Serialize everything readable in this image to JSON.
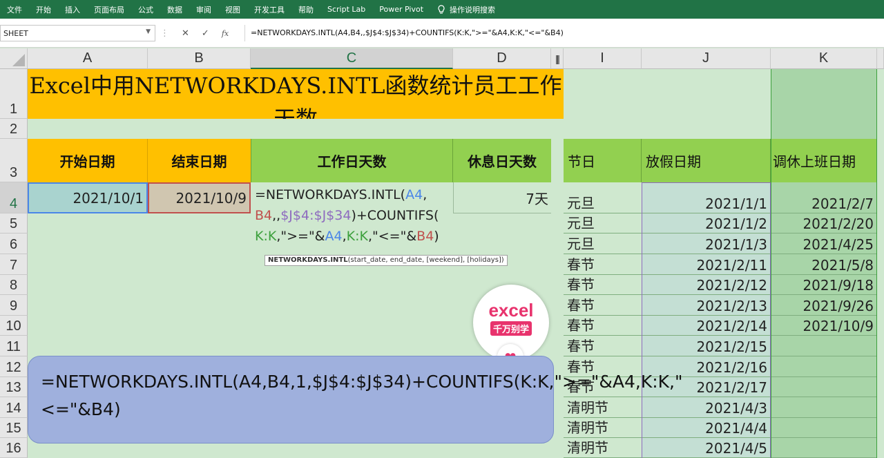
{
  "ribbon": {
    "tabs": [
      "文件",
      "开始",
      "插入",
      "页面布局",
      "公式",
      "数据",
      "审阅",
      "视图",
      "开发工具",
      "帮助",
      "Script Lab",
      "Power Pivot"
    ],
    "tell_me": "操作说明搜索"
  },
  "formula_bar": {
    "name_box": "SHEET",
    "formula": "=NETWORKDAYS.INTL(A4,B4,,$J$4:$J$34)+COUNTIFS(K:K,\">=\"&A4,K:K,\"<=\"&B4)",
    "fx": "fx"
  },
  "columns": [
    {
      "label": "A"
    },
    {
      "label": "B"
    },
    {
      "label": "C"
    },
    {
      "label": "D"
    },
    {
      "label": "I"
    },
    {
      "label": "J"
    },
    {
      "label": "K"
    }
  ],
  "rows": [
    "1",
    "2",
    "3",
    "4",
    "5",
    "6",
    "7",
    "8",
    "9",
    "10",
    "11",
    "12",
    "13",
    "14",
    "15",
    "16"
  ],
  "title": "Excel中用NETWORKDAYS.INTL函数统计员工工作天数",
  "headers": {
    "start": "开始日期",
    "end": "结束日期",
    "workdays": "工作日天数",
    "restdays": "休息日天数",
    "holiday": "节日",
    "holiday_date": "放假日期",
    "makeup_date": "调休上班日期"
  },
  "row4": {
    "start": "2021/10/1",
    "end": "2021/10/9",
    "rest": "7天"
  },
  "edit_formula": {
    "l1a": "=NETWORKDAYS.INTL(",
    "l1b": "A4",
    "l1c": ",",
    "l2a": "B4",
    "l2b": ",,",
    "l2c": "$J$4:$J$34",
    "l2d": ")+COUNTIFS(",
    "l3a": "K:K",
    "l3b": ",\">=\"&",
    "l3c": "A4",
    "l3d": ",",
    "l3e": "K:K",
    "l3f": ",\"<=\"&",
    "l3g": "B4",
    "l3h": ")"
  },
  "tooltip": {
    "fn": "NETWORKDAYS.INTL",
    "args": "(start_date, end_date, [weekend], [holidays])"
  },
  "holidays": [
    {
      "name": "元旦",
      "date": "2021/1/1",
      "makeup": "2021/2/7"
    },
    {
      "name": "元旦",
      "date": "2021/1/2",
      "makeup": "2021/2/20"
    },
    {
      "name": "元旦",
      "date": "2021/1/3",
      "makeup": "2021/4/25"
    },
    {
      "name": "春节",
      "date": "2021/2/11",
      "makeup": "2021/5/8"
    },
    {
      "name": "春节",
      "date": "2021/2/12",
      "makeup": "2021/9/18"
    },
    {
      "name": "春节",
      "date": "2021/2/13",
      "makeup": "2021/9/26"
    },
    {
      "name": "春节",
      "date": "2021/2/14",
      "makeup": "2021/10/9"
    },
    {
      "name": "春节",
      "date": "2021/2/15",
      "makeup": ""
    },
    {
      "name": "春节",
      "date": "2021/2/16",
      "makeup": ""
    },
    {
      "name": "春节",
      "date": "2021/2/17",
      "makeup": ""
    },
    {
      "name": "清明节",
      "date": "2021/4/3",
      "makeup": ""
    },
    {
      "name": "清明节",
      "date": "2021/4/4",
      "makeup": ""
    },
    {
      "name": "清明节",
      "date": "2021/4/5",
      "makeup": ""
    }
  ],
  "callout": "=NETWORKDAYS.INTL(A4,B4,1,$J$4:$J$34)+COUNTIFS(K:K,\">=\"&A4,K:K,\"<=\"&B4)",
  "logo": {
    "line1": "excel",
    "line2": "千万别学"
  },
  "colors": {
    "ribbon": "#217346",
    "orange": "#ffc000",
    "green": "#92d050",
    "blue_ref": "#4a86e8",
    "red_ref": "#c0504d",
    "purple_ref": "#8e6bbf",
    "green_ref": "#3ca03c"
  }
}
